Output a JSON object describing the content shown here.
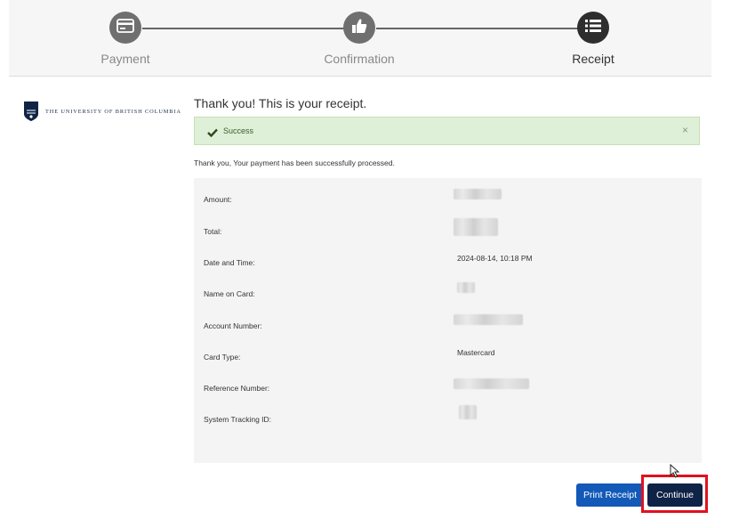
{
  "steps": [
    {
      "label": "Payment",
      "icon": "credit-card-icon",
      "state": "done"
    },
    {
      "label": "Confirmation",
      "icon": "thumbs-up-icon",
      "state": "done"
    },
    {
      "label": "Receipt",
      "icon": "list-icon",
      "state": "active"
    }
  ],
  "logo": {
    "text": "THE UNIVERSITY OF BRITISH COLUMBIA",
    "seal_text": "UBC"
  },
  "title": "Thank you! This is your receipt.",
  "alert": {
    "text": "Success",
    "close": "×"
  },
  "message": "Thank you, Your payment has been successfully processed.",
  "receipt": {
    "rows": [
      {
        "label": "Amount:",
        "value": "",
        "redacted": true
      },
      {
        "label": "Total:",
        "value": "",
        "redacted": true
      },
      {
        "label": "Date and Time:",
        "value": "2024-08-14, 10:18 PM",
        "redacted": false
      },
      {
        "label": "Name on Card:",
        "value": "",
        "redacted": true
      },
      {
        "label": "Account Number:",
        "value": "",
        "redacted": true
      },
      {
        "label": "Card Type:",
        "value": "Mastercard",
        "redacted": false
      },
      {
        "label": "Reference Number:",
        "value": "",
        "redacted": true
      },
      {
        "label": "System Tracking ID:",
        "value": "",
        "redacted": true
      }
    ]
  },
  "buttons": {
    "print": "Print Receipt",
    "continue": "Continue"
  },
  "colors": {
    "primary": "#1259b8",
    "dark": "#0f2346",
    "success_bg": "#dff0d8",
    "highlight": "#e0111f"
  }
}
